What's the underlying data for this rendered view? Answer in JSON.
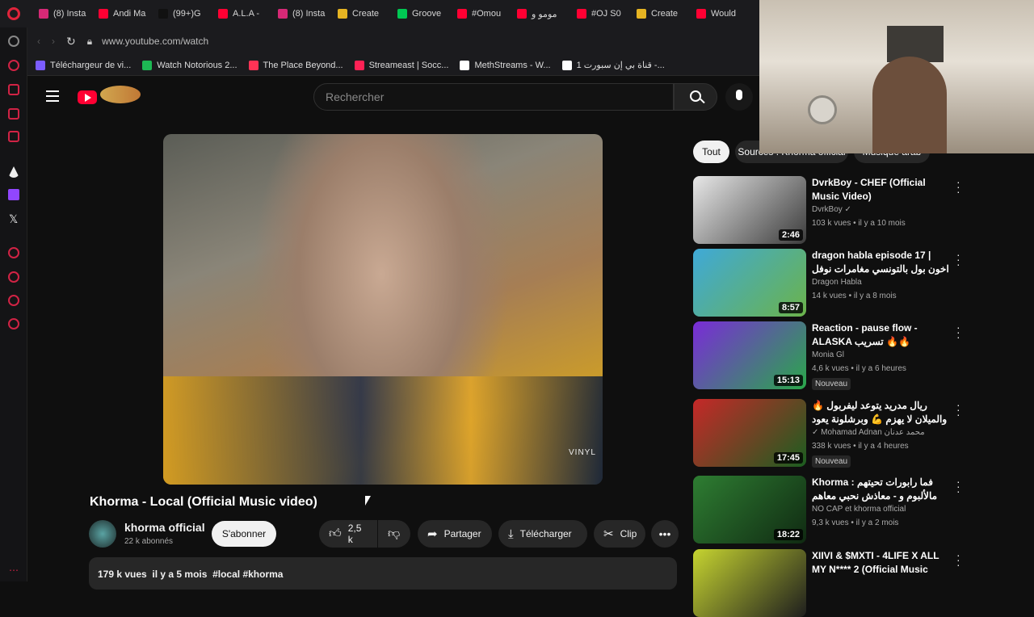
{
  "browser": {
    "tabs": [
      {
        "label": "(8) Insta",
        "color": "#d62976"
      },
      {
        "label": "Andi Ma",
        "color": "#ff0033"
      },
      {
        "label": "(99+)G",
        "color": "#111111"
      },
      {
        "label": "A.L.A -",
        "color": "#ff0033"
      },
      {
        "label": "(8) Insta",
        "color": "#d62976"
      },
      {
        "label": "Create",
        "color": "#e6b422"
      },
      {
        "label": "Groove",
        "color": "#00c853"
      },
      {
        "label": "#Omou",
        "color": "#ff0033"
      },
      {
        "label": "مومو و",
        "color": "#ff0033"
      },
      {
        "label": "#OJ S0",
        "color": "#ff0033"
      },
      {
        "label": "Create",
        "color": "#e6b422"
      },
      {
        "label": "Would",
        "color": "#ff0033"
      }
    ],
    "url": "www.youtube.com/watch",
    "bookmarks": [
      {
        "label": "Téléchargeur de vi...",
        "color": "#7b5cff"
      },
      {
        "label": "Watch Notorious 2...",
        "color": "#1db954"
      },
      {
        "label": "The Place Beyond...",
        "color": "#ff3355"
      },
      {
        "label": "Streameast | Socc...",
        "color": "#ff2255"
      },
      {
        "label": "MethStreams - W...",
        "color": "#ffffff"
      },
      {
        "label": "قناة بي إن سبورت 1 -...",
        "color": "#ffffff"
      }
    ]
  },
  "youtube": {
    "search_placeholder": "Rechercher",
    "video": {
      "title": "Khorma - Local (Official Music video)",
      "watermark": "VINYL",
      "channel": "khorma official",
      "subscribers": "22 k abonnés",
      "subscribe_label": "S'abonner",
      "likes": "2,5 k",
      "share_label": "Partager",
      "download_label": "Télécharger",
      "clip_label": "Clip",
      "description_line": "179 k vues  il y a 5 mois  #local #khorma"
    },
    "filter_chips": [
      "Tout",
      "Sources : Khorma official",
      "Musique arab"
    ],
    "recommendations": [
      {
        "title": "DvrkBoy - CHEF (Official Music Video)",
        "channel": "DvrkBoy ✓",
        "meta": "103 k vues • il y a 10 mois",
        "duration": "2:46",
        "badge": "",
        "thumb_from": "#e8e8e8",
        "thumb_to": "#3b3b3b"
      },
      {
        "title": "dragon habla episode 17 | اخون بول بالتونسي مغامرات نوفل وعمك...",
        "channel": "Dragon Habla",
        "meta": "14 k vues • il y a 8 mois",
        "duration": "8:57",
        "badge": "",
        "thumb_from": "#3fa9d8",
        "thumb_to": "#6bb34a"
      },
      {
        "title": "Reaction - pause flow - ALASKA تسريب 🔥🔥",
        "channel": "Monia Gl",
        "meta": "4,6 k vues • il y a 6 heures",
        "duration": "15:13",
        "badge": "Nouveau",
        "thumb_from": "#7a2bd8",
        "thumb_to": "#2aa84a"
      },
      {
        "title": "ريال مدريد يتوعد ليفربول 🔥 والميلان لا يهزم 💪 وبرشلونة يعود للانتصارات ✅",
        "channel": "✓ Mohamad Adnan محمد عدنان",
        "meta": "338 k vues • il y a 4 heures",
        "duration": "17:45",
        "badge": "Nouveau",
        "thumb_from": "#c62828",
        "thumb_to": "#1b5e20"
      },
      {
        "title": "Khorma : فما رابورات تحيتهم مالألبوم و - معاذش نحبي معاهم حياتي كاملة Q&R E...",
        "channel": "NO CAP et khorma official",
        "meta": "9,3 k vues • il y a 2 mois",
        "duration": "18:22",
        "badge": "",
        "thumb_from": "#2e7d32",
        "thumb_to": "#102a12"
      },
      {
        "title": "XIIVI & $MXTI - 4LIFE X ALL MY N**** 2 (Official Music Video)",
        "channel": "",
        "meta": "",
        "duration": "",
        "badge": "",
        "thumb_from": "#c6d430",
        "thumb_to": "#1e1e1e"
      }
    ]
  }
}
